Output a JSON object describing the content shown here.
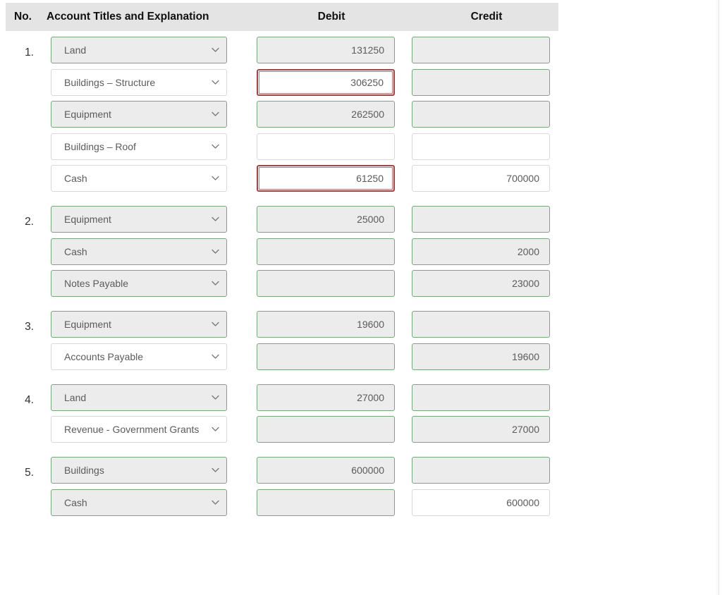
{
  "table": {
    "columns": {
      "no": "No.",
      "account": "Account Titles and Explanation",
      "debit": "Debit",
      "credit": "Credit"
    },
    "colors": {
      "header_band": "#e4e4e4",
      "valid_border": "#76a87c",
      "valid_fill": "#ececec",
      "error_border": "#a94442",
      "neutral_border": "#d8d8d8",
      "text": "#5b5b5b"
    },
    "icons": {
      "select_chevron": "chevron-down-icon"
    },
    "entries": [
      {
        "no": "1.",
        "lines": [
          {
            "account": "Land",
            "account_state": "valid",
            "debit": "131250",
            "debit_state": "valid",
            "credit": "",
            "credit_state": "valid"
          },
          {
            "account": "Buildings – Structure",
            "account_state": "neutral",
            "debit": "306250",
            "debit_state": "error",
            "credit": "",
            "credit_state": "valid"
          },
          {
            "account": "Equipment",
            "account_state": "valid",
            "debit": "262500",
            "debit_state": "valid",
            "credit": "",
            "credit_state": "valid"
          },
          {
            "account": "Buildings – Roof",
            "account_state": "neutral",
            "debit": "",
            "debit_state": "neutral",
            "credit": "",
            "credit_state": "neutral"
          },
          {
            "account": "Cash",
            "account_state": "neutral",
            "debit": "61250",
            "debit_state": "error",
            "credit": "700000",
            "credit_state": "neutral"
          }
        ]
      },
      {
        "no": "2.",
        "lines": [
          {
            "account": "Equipment",
            "account_state": "valid",
            "debit": "25000",
            "debit_state": "valid",
            "credit": "",
            "credit_state": "valid"
          },
          {
            "account": "Cash",
            "account_state": "valid",
            "debit": "",
            "debit_state": "valid",
            "credit": "2000",
            "credit_state": "valid"
          },
          {
            "account": "Notes Payable",
            "account_state": "valid",
            "debit": "",
            "debit_state": "valid",
            "credit": "23000",
            "credit_state": "valid"
          }
        ]
      },
      {
        "no": "3.",
        "lines": [
          {
            "account": "Equipment",
            "account_state": "valid",
            "debit": "19600",
            "debit_state": "valid",
            "credit": "",
            "credit_state": "valid"
          },
          {
            "account": "Accounts Payable",
            "account_state": "neutral",
            "debit": "",
            "debit_state": "valid",
            "credit": "19600",
            "credit_state": "valid"
          }
        ]
      },
      {
        "no": "4.",
        "lines": [
          {
            "account": "Land",
            "account_state": "valid",
            "debit": "27000",
            "debit_state": "valid",
            "credit": "",
            "credit_state": "valid"
          },
          {
            "account": "Revenue - Government Grants",
            "account_state": "neutral",
            "debit": "",
            "debit_state": "valid",
            "credit": "27000",
            "credit_state": "valid"
          }
        ]
      },
      {
        "no": "5.",
        "lines": [
          {
            "account": "Buildings",
            "account_state": "valid",
            "debit": "600000",
            "debit_state": "valid",
            "credit": "",
            "credit_state": "valid"
          },
          {
            "account": "Cash",
            "account_state": "valid",
            "debit": "",
            "debit_state": "valid",
            "credit": "600000",
            "credit_state": "neutral"
          }
        ]
      }
    ]
  }
}
